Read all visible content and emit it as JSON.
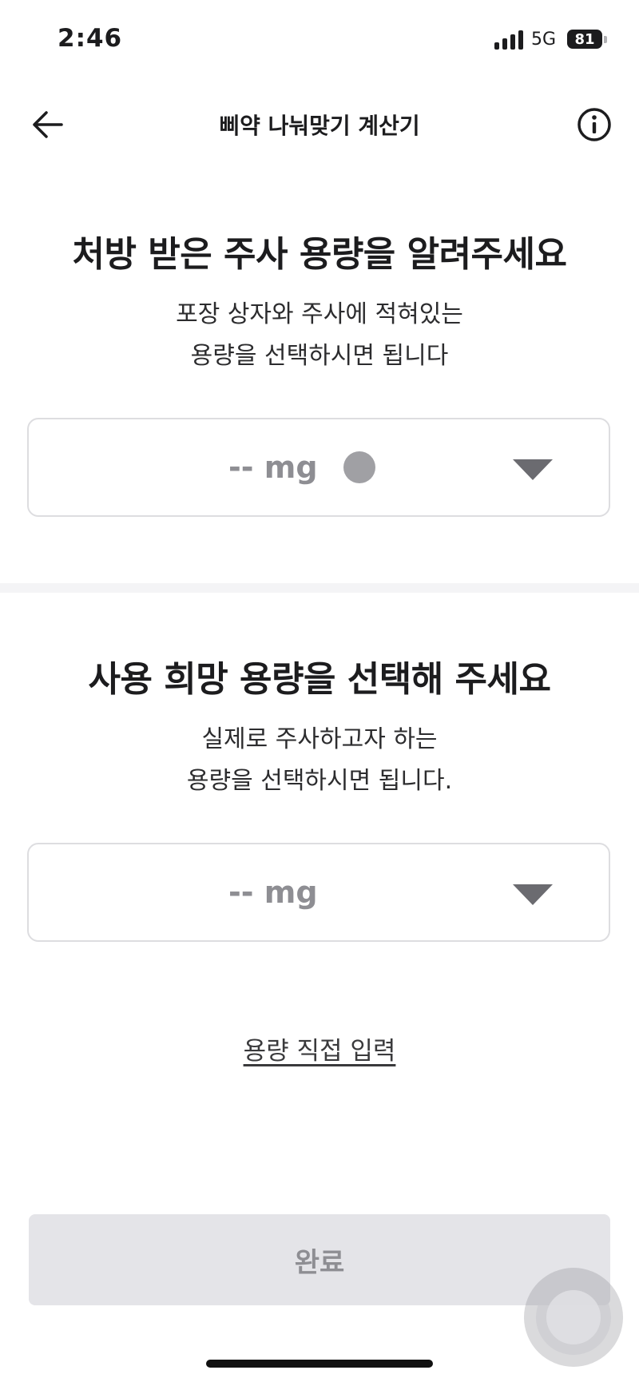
{
  "status_bar": {
    "time": "2:46",
    "network": "5G",
    "battery": "81"
  },
  "nav": {
    "title": "삐약 나눠맞기 계산기"
  },
  "prescribed": {
    "title": "처방 받은 주사 용량을 알려주세요",
    "desc_line1": "포장 상자와 주사에 적혀있는",
    "desc_line2": "용량을 선택하시면 됩니다",
    "value": "-- mg"
  },
  "desired": {
    "title": "사용 희망 용량을 선택해 주세요",
    "desc_line1": "실제로 주사하고자 하는",
    "desc_line2": "용량을 선택하시면 됩니다.",
    "value": "-- mg"
  },
  "manual_input_label": "용량 직접 입력",
  "done_label": "완료",
  "colors": {
    "text": "#1c1c1e",
    "placeholder": "#8e8e93",
    "disabled_button": "#e4e4e8",
    "border": "#dddde0"
  },
  "icons": {
    "back": "arrow-left-icon",
    "info": "info-circle-icon",
    "dropdown": "triangle-down-icon"
  }
}
